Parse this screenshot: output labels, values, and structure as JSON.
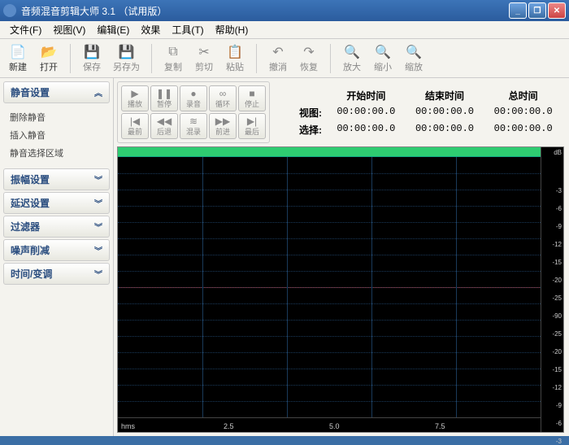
{
  "window": {
    "title": "音频混音剪辑大师  3.1 （试用版）"
  },
  "menu": {
    "file": "文件(F)",
    "view": "视图(V)",
    "edit": "编辑(E)",
    "effects": "效果",
    "tools": "工具(T)",
    "help": "帮助(H)"
  },
  "toolbar": {
    "new": "新建",
    "open": "打开",
    "save": "保存",
    "saveas": "另存为",
    "copy": "复制",
    "cut": "剪切",
    "paste": "粘贴",
    "undo": "撤消",
    "redo": "恢复",
    "zoomin": "放大",
    "zoomout": "缩小",
    "zoomfit": "缩放"
  },
  "panels": [
    {
      "title": "静音设置",
      "expanded": true,
      "items": [
        "删除静音",
        "插入静音",
        "静音选择区域"
      ]
    },
    {
      "title": "振幅设置",
      "expanded": false,
      "items": []
    },
    {
      "title": "延迟设置",
      "expanded": false,
      "items": []
    },
    {
      "title": "过滤器",
      "expanded": false,
      "items": []
    },
    {
      "title": "噪声削减",
      "expanded": false,
      "items": []
    },
    {
      "title": "时间/变调",
      "expanded": false,
      "items": []
    }
  ],
  "transport": {
    "row1": [
      {
        "icon": "▶",
        "label": "播放"
      },
      {
        "icon": "❚❚",
        "label": "暂停"
      },
      {
        "icon": "●",
        "label": "录音"
      },
      {
        "icon": "∞",
        "label": "循环"
      },
      {
        "icon": "■",
        "label": "停止"
      }
    ],
    "row2": [
      {
        "icon": "|◀",
        "label": "最前"
      },
      {
        "icon": "◀◀",
        "label": "后退"
      },
      {
        "icon": "≋",
        "label": "混录"
      },
      {
        "icon": "▶▶",
        "label": "前进"
      },
      {
        "icon": "▶|",
        "label": "最后"
      }
    ]
  },
  "time": {
    "col_start": "开始时间",
    "col_end": "结束时间",
    "col_total": "总时间",
    "row_view": "视图:",
    "row_select": "选择:",
    "v_start": "00:00:00.0",
    "v_end": "00:00:00.0",
    "v_total": "00:00:00.0",
    "s_start": "00:00:00.0",
    "s_end": "00:00:00.0",
    "s_total": "00:00:00.0"
  },
  "ruler": {
    "unit": "hms",
    "ticks": [
      "2.5",
      "5.0",
      "7.5"
    ]
  },
  "db": {
    "label": "dB",
    "values": [
      "-3",
      "-6",
      "-9",
      "-12",
      "-15",
      "-20",
      "-25",
      "-90",
      "-25",
      "-20",
      "-15",
      "-12",
      "-9",
      "-6",
      "-3"
    ]
  }
}
